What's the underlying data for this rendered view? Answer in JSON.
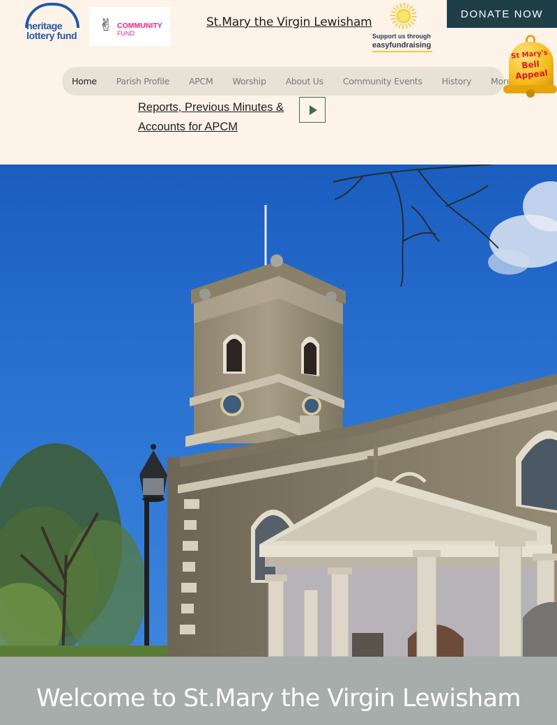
{
  "logos": {
    "heritage_line1": "heritage",
    "heritage_line2": "lottery fund",
    "community_line1": "COMMUNITY",
    "community_line2": "FUND",
    "easy_line1": "Support us through",
    "easy_line2": "easyfundraising"
  },
  "site_title": "St.Mary the Virgin Lewisham",
  "donate_label": "DONATE NOW",
  "nav": {
    "items": [
      "Home",
      "Parish Profile",
      "APCM",
      "Worship",
      "About Us",
      "Community Events",
      "History",
      "More"
    ],
    "active": "Home"
  },
  "bell": {
    "line1": "St Mary's",
    "line2": "Bell",
    "line3": "Appeal"
  },
  "reports_link": "Reports, Previous Minutes & Accounts for APCM",
  "welcome_title": "Welcome to St.Mary the Virgin Lewisham",
  "colors": {
    "page_bg": "#fdf3e8",
    "donate_bg": "#1f3f48",
    "nav_bg": "#e8e2d6",
    "welcome_band": "#a7adab"
  },
  "icons": {
    "play": "play-icon",
    "bell": "bell-icon"
  }
}
